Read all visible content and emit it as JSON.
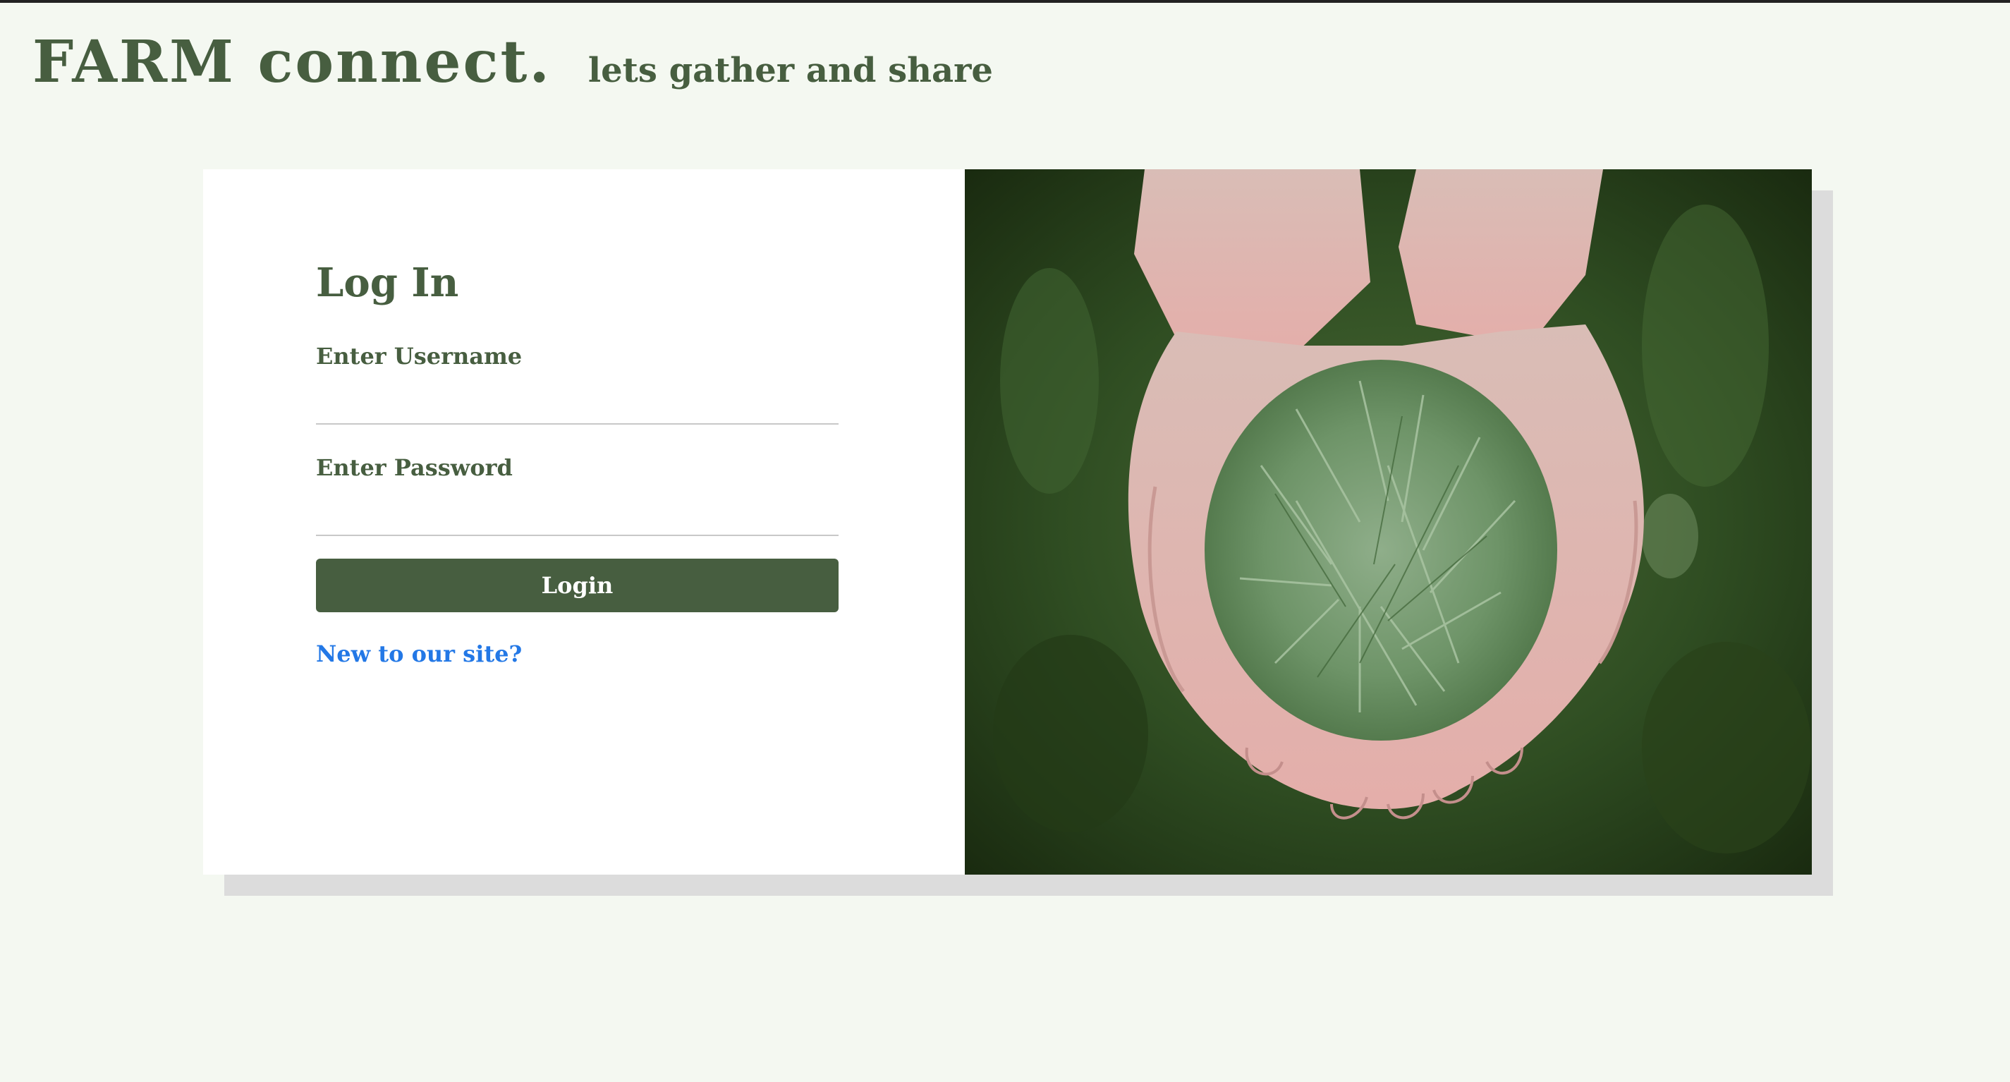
{
  "header": {
    "brand": "FARM connect.",
    "tagline": "lets gather and share"
  },
  "login": {
    "title": "Log In",
    "username_label": "Enter Username",
    "username_value": "",
    "password_label": "Enter Password",
    "password_value": "",
    "button_label": "Login",
    "signup_link": "New to our site?"
  },
  "colors": {
    "background": "#f4f8f1",
    "brand_green": "#475e40",
    "link_blue": "#2378e6",
    "card_shadow": "#dcdcdc"
  },
  "photo": {
    "icon": "hands-holding-pine-needles-image"
  }
}
